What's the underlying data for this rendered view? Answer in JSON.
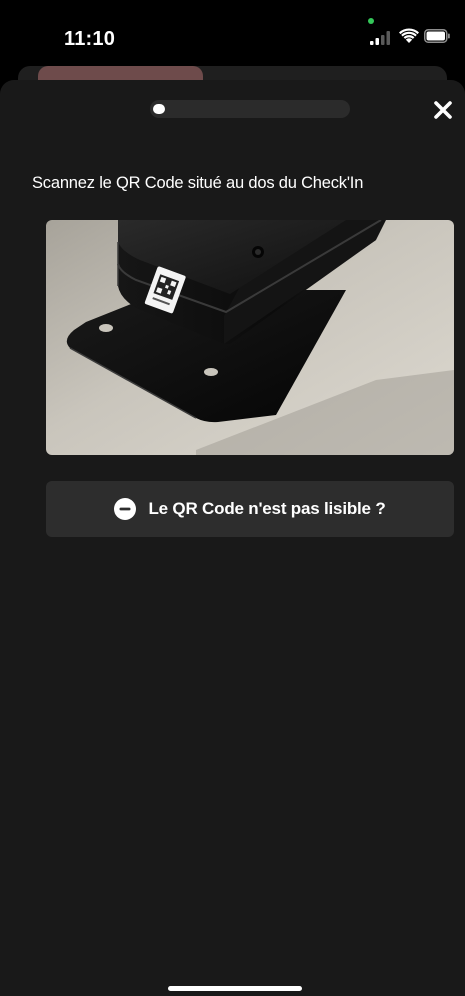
{
  "status_bar": {
    "time": "11:10",
    "mic_indicator_color": "#34c759"
  },
  "background_card": {
    "accent_color": "#6e4b4b"
  },
  "sheet": {
    "progress": 0.06,
    "close_icon": "close-icon",
    "instruction": "Scannez le QR Code situé au dos du Check'In",
    "photo_icon": "device-photo",
    "help_button": {
      "icon": "minus-circle-icon",
      "label": "Le QR Code n'est pas lisible ?"
    }
  },
  "colors": {
    "sheet_background": "#191919",
    "button_background": "#2d2d2d",
    "text": "#ffffff"
  }
}
